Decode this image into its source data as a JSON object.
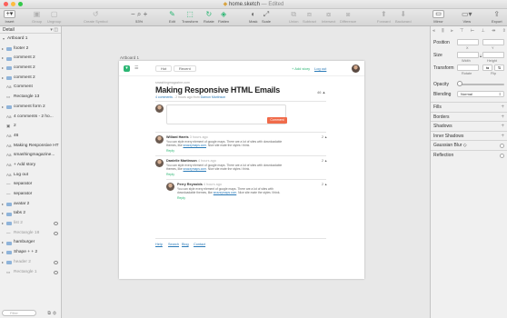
{
  "window": {
    "title": "home.sketch",
    "status": "— Edited",
    "lights": [
      "#fc605b",
      "#fdbc40",
      "#34c84a"
    ]
  },
  "toolbar": {
    "insert": "Insert",
    "group": "Group",
    "ungroup": "Ungroup",
    "create_symbol": "Create Symbol",
    "zoom": "53%",
    "edit": "Edit",
    "transform": "Transform",
    "rotate": "Rotate",
    "flatten": "Flatten",
    "mask": "Mask",
    "scale": "Scale",
    "union": "Union",
    "subtract": "Subtract",
    "intersect": "Intersect",
    "difference": "Difference",
    "forward": "Forward",
    "backward": "Backward",
    "mirror": "Mirror",
    "view": "View",
    "export": "Export"
  },
  "left_panel": {
    "page": "Detail",
    "artboard": "Artboard 1",
    "layers": [
      {
        "name": "footer 2",
        "kind": "group",
        "expanded": false
      },
      {
        "name": "comment 2",
        "kind": "group",
        "expanded": false
      },
      {
        "name": "comment 2",
        "kind": "group",
        "expanded": false
      },
      {
        "name": "comment 2",
        "kind": "group",
        "expanded": false
      },
      {
        "name": "Comment",
        "kind": "text"
      },
      {
        "name": "Rectangle 13",
        "kind": "shape"
      },
      {
        "name": "comment form 2",
        "kind": "group",
        "expanded": false
      },
      {
        "name": "4 comments - 2 ho...",
        "kind": "text"
      },
      {
        "name": "2",
        "kind": "image"
      },
      {
        "name": "46",
        "kind": "text"
      },
      {
        "name": "Making Responsive HT",
        "kind": "text"
      },
      {
        "name": "smashingmagazine...",
        "kind": "text"
      },
      {
        "name": "+ Add story",
        "kind": "text"
      },
      {
        "name": "Log out",
        "kind": "text"
      },
      {
        "name": "separator",
        "kind": "line"
      },
      {
        "name": "separator",
        "kind": "line"
      },
      {
        "name": "avatar 2",
        "kind": "group",
        "expanded": false
      },
      {
        "name": "tabs 2",
        "kind": "group",
        "expanded": false
      },
      {
        "name": "list 2",
        "kind": "group",
        "expanded": false,
        "faded": true,
        "hidden_icon": true
      },
      {
        "name": "Rectangle 18",
        "kind": "line",
        "faded": true,
        "hidden_icon": true
      },
      {
        "name": "hamburger",
        "kind": "group",
        "expanded": false
      },
      {
        "name": "Shape + + 2",
        "kind": "group",
        "expanded": false
      },
      {
        "name": "header 2",
        "kind": "group",
        "expanded": false,
        "faded": true,
        "hidden_icon": true
      },
      {
        "name": "Rectangle 1",
        "kind": "shape",
        "faded": true,
        "hidden_icon": true
      }
    ],
    "filter_placeholder": "Filter"
  },
  "canvas": {
    "artboard_label": "Artboard 1",
    "site": {
      "tabs": [
        "Hot",
        "Recent"
      ],
      "add_story": "+ Add story",
      "logout": "Log out",
      "domain": "smashingmagazine.com",
      "post_title": "Making Responsive HTML Emails",
      "post_author_prefix": "4 comments",
      "post_author_rest": " - 2 hours ago from",
      "post_author_link": "Damon Martinson",
      "post_count": "46 ▲",
      "comment_button": "Comment",
      "comments": [
        {
          "name": "Willard Harris",
          "time": "3 hours ago",
          "text_a": "You can style every element of google maps. There are a lot of sites with downloadable",
          "text_b": "themes, like ",
          "link": "snazzymaps.com",
          "text_c": ". Nice site mate the styles I think.",
          "reply": "Reply",
          "count": "2 ▲"
        },
        {
          "name": "Danielle Martinson",
          "time": "4 hours ago",
          "text_a": "You can style every element of google maps. There are a lot of sites with downloadable",
          "text_b": "themes, like ",
          "link": "snazzymaps.com",
          "text_c": ". Nice site mate the styles I think.",
          "reply": "Reply",
          "count": "2 ▲"
        },
        {
          "name": "Perry Reynolds",
          "time": "4 hours ago",
          "text_a": "You can style every element of google maps. There are a lot of sites with",
          "text_b": "downloadable themes, like ",
          "link": "snazzymaps.com",
          "text_c": ". Nice site mate the styles I think.",
          "reply": "Reply",
          "count": "2 ▲"
        }
      ],
      "footer_links": [
        "Help",
        "Search",
        "Blog",
        "Contact"
      ]
    }
  },
  "inspector": {
    "position": "Position",
    "x_label": "X",
    "y_label": "Y",
    "size": "Size",
    "width": "Width",
    "height": "Height",
    "transform": "Transform",
    "rotate": "Rotate",
    "flip": "Flip",
    "opacity": "Opacity",
    "opacity_value": 0.05,
    "blending": "Blending",
    "blending_value": "Normal",
    "sections": [
      "Fills",
      "Borders",
      "Shadows",
      "Inner Shadows",
      "Gaussian Blur ◇",
      "Reflection"
    ]
  }
}
